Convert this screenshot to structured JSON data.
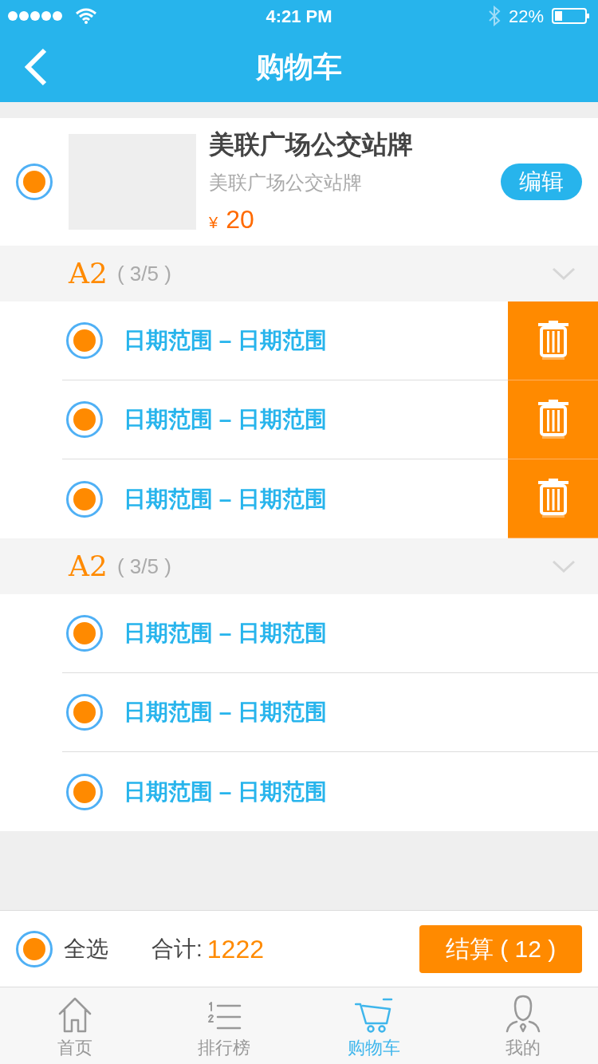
{
  "status_bar": {
    "time": "4:21 PM",
    "battery": "22%"
  },
  "nav": {
    "title": "购物车"
  },
  "product": {
    "selected": true,
    "name": "美联广场公交站牌",
    "subtitle": "美联广场公交站牌",
    "currency": "¥",
    "price": "20",
    "edit": "编辑"
  },
  "groups": [
    {
      "name": "A2",
      "count": "( 3/5 )",
      "expanded": true,
      "items": [
        {
          "label": "日期范围 – 日期范围",
          "selected": true,
          "swiped": true
        },
        {
          "label": "日期范围 – 日期范围",
          "selected": true,
          "swiped": true
        },
        {
          "label": "日期范围 – 日期范围",
          "selected": true,
          "swiped": true
        }
      ]
    },
    {
      "name": "A2",
      "count": "( 3/5 )",
      "expanded": true,
      "items": [
        {
          "label": "日期范围 – 日期范围",
          "selected": true,
          "swiped": false
        },
        {
          "label": "日期范围 – 日期范围",
          "selected": true,
          "swiped": false
        },
        {
          "label": "日期范围 – 日期范围",
          "selected": true,
          "swiped": false
        }
      ]
    }
  ],
  "footer": {
    "select_all": {
      "label": "全选",
      "selected": true
    },
    "total_label": "合计:",
    "total": "1222",
    "checkout": "结算 ( 12 )"
  },
  "tab_bar": [
    {
      "kind": "home",
      "label": "首页",
      "selected": false
    },
    {
      "kind": "ranking",
      "label": "排行榜",
      "selected": false
    },
    {
      "kind": "cart",
      "label": "购物车",
      "selected": true
    },
    {
      "kind": "profile",
      "label": "我的",
      "selected": false
    }
  ]
}
